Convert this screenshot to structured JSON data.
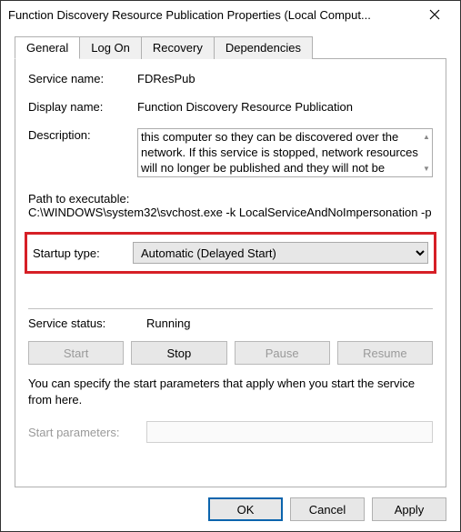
{
  "titlebar": {
    "title": "Function Discovery Resource Publication Properties (Local Comput..."
  },
  "tabs": {
    "general": "General",
    "logon": "Log On",
    "recovery": "Recovery",
    "dependencies": "Dependencies"
  },
  "labels": {
    "service_name": "Service name:",
    "display_name": "Display name:",
    "description": "Description:",
    "path_label": "Path to executable:",
    "startup_type": "Startup type:",
    "service_status": "Service status:",
    "start_parameters": "Start parameters:"
  },
  "values": {
    "service_name": "FDResPub",
    "display_name": "Function Discovery Resource Publication",
    "description": "this computer so they can be discovered over the network.  If this service is stopped, network resources will no longer be published and they will not be",
    "path": "C:\\WINDOWS\\system32\\svchost.exe -k LocalServiceAndNoImpersonation -p",
    "startup_type": "Automatic (Delayed Start)",
    "service_status": "Running",
    "start_parameters": ""
  },
  "buttons": {
    "start": "Start",
    "stop": "Stop",
    "pause": "Pause",
    "resume": "Resume",
    "ok": "OK",
    "cancel": "Cancel",
    "apply": "Apply"
  },
  "hint": "You can specify the start parameters that apply when you start the service from here."
}
